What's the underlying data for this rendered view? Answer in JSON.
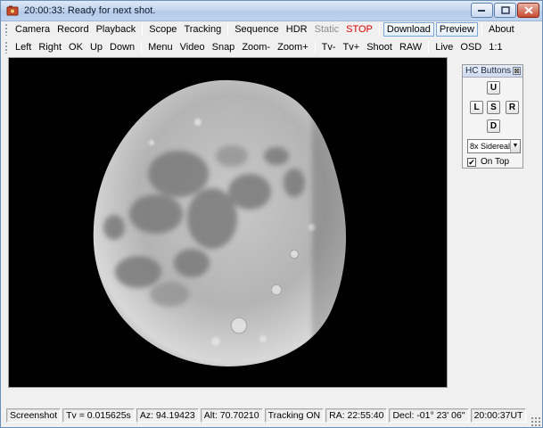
{
  "window": {
    "title": "20:00:33: Ready for next shot."
  },
  "menubar1": {
    "items": [
      {
        "label": "Camera"
      },
      {
        "label": "Record"
      },
      {
        "label": "Playback"
      },
      {
        "label": "Scope"
      },
      {
        "label": "Tracking"
      },
      {
        "label": "Sequence"
      },
      {
        "label": "HDR"
      },
      {
        "label": "Static"
      },
      {
        "label": "STOP"
      },
      {
        "label": "Download"
      },
      {
        "label": "Preview"
      },
      {
        "label": "About"
      }
    ]
  },
  "menubar2": {
    "items": [
      {
        "label": "Left"
      },
      {
        "label": "Right"
      },
      {
        "label": "OK"
      },
      {
        "label": "Up"
      },
      {
        "label": "Down"
      },
      {
        "label": "Menu"
      },
      {
        "label": "Video"
      },
      {
        "label": "Snap"
      },
      {
        "label": "Zoom-"
      },
      {
        "label": "Zoom+"
      },
      {
        "label": "Tv-"
      },
      {
        "label": "Tv+"
      },
      {
        "label": "Shoot"
      },
      {
        "label": "RAW"
      },
      {
        "label": "Live"
      },
      {
        "label": "OSD"
      },
      {
        "label": "1:1"
      }
    ]
  },
  "hc_panel": {
    "title": "HC Buttons",
    "close_glyph": "⊠",
    "buttons": {
      "up": "U",
      "left": "L",
      "stop": "S",
      "right": "R",
      "down": "D"
    },
    "rate_selected": "8x Sidereal",
    "on_top_label": "On Top",
    "on_top_checked": true
  },
  "statusbar": {
    "screenshot": "Screenshot",
    "tv": "Tv = 0.015625s",
    "az": "Az: 94.19423",
    "alt": "Alt: 70.70210",
    "tracking": "Tracking ON",
    "ra": "RA: 22:55:40",
    "decl": "Decl: -01° 23' 06\"",
    "time": "20:00:37UT"
  },
  "colors": {
    "stop": "#e00000",
    "disabled": "#8c8c8c",
    "image_bg": "#000000"
  }
}
